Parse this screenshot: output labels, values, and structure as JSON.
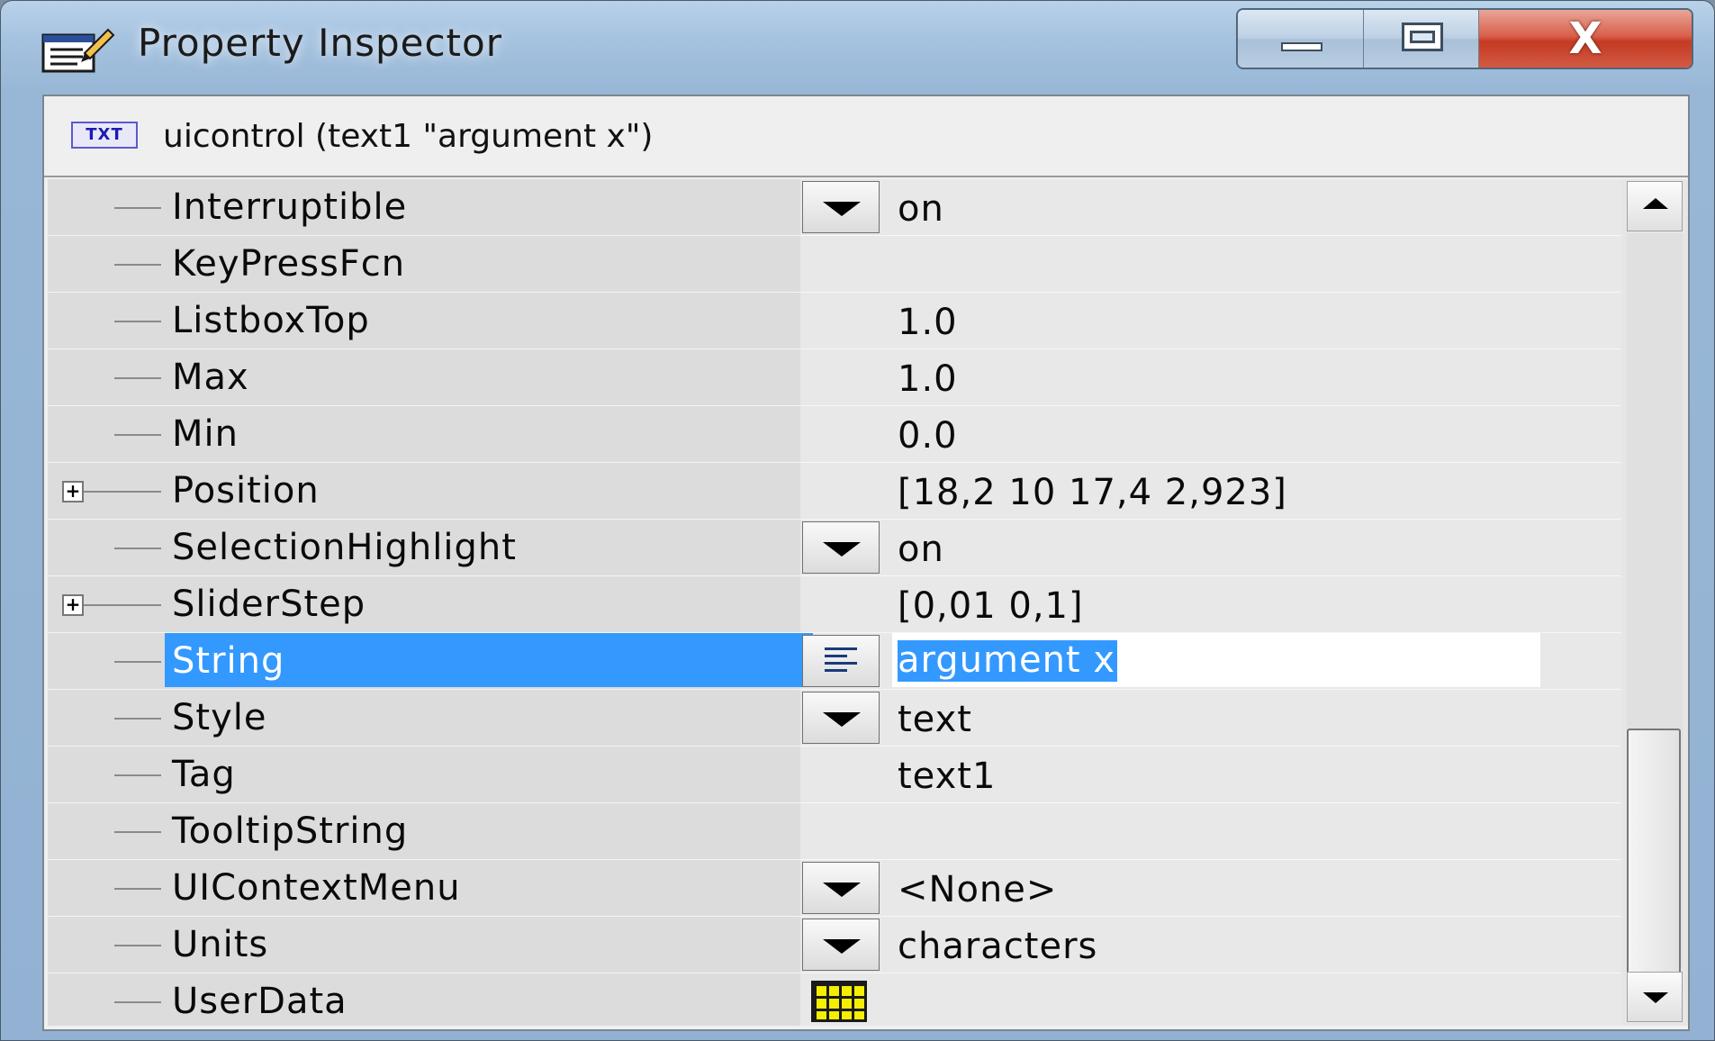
{
  "window": {
    "title": "Property Inspector",
    "controls": {
      "minimize": "minimize",
      "maximize": "maximize",
      "close": "X"
    }
  },
  "header": {
    "icon_text": "TXT",
    "label": "uicontrol (text1 \"argument x\")"
  },
  "properties": [
    {
      "name": "Interruptible",
      "value": "on",
      "editor": "dropdown",
      "expandable": false
    },
    {
      "name": "KeyPressFcn",
      "value": "",
      "editor": "none",
      "expandable": false
    },
    {
      "name": "ListboxTop",
      "value": "1.0",
      "editor": "none",
      "expandable": false
    },
    {
      "name": "Max",
      "value": "1.0",
      "editor": "none",
      "expandable": false
    },
    {
      "name": "Min",
      "value": "0.0",
      "editor": "none",
      "expandable": false
    },
    {
      "name": "Position",
      "value": "[18,2 10 17,4 2,923]",
      "editor": "none",
      "expandable": true
    },
    {
      "name": "SelectionHighlight",
      "value": "on",
      "editor": "dropdown",
      "expandable": false
    },
    {
      "name": "SliderStep",
      "value": "[0,01 0,1]",
      "editor": "none",
      "expandable": true
    },
    {
      "name": "String",
      "value": "argument x",
      "editor": "text",
      "expandable": false,
      "selected": true
    },
    {
      "name": "Style",
      "value": "text",
      "editor": "dropdown",
      "expandable": false
    },
    {
      "name": "Tag",
      "value": "text1",
      "editor": "none",
      "expandable": false
    },
    {
      "name": "TooltipString",
      "value": "",
      "editor": "none",
      "expandable": false
    },
    {
      "name": "UIContextMenu",
      "value": "<None>",
      "editor": "dropdown",
      "expandable": false
    },
    {
      "name": "Units",
      "value": "characters",
      "editor": "dropdown",
      "expandable": false
    },
    {
      "name": "UserData",
      "value": "",
      "editor": "grid",
      "expandable": false
    }
  ],
  "icons": {
    "title_icon": "property-inspector-icon",
    "dropdown": "chevron-down-icon",
    "text_editor": "text-lines-icon",
    "array_editor": "grid-icon",
    "expand": "plus-expander-icon"
  },
  "colors": {
    "selection": "#3399ff",
    "title_bar": "#a6c3e0",
    "close_button": "#c43a22"
  }
}
